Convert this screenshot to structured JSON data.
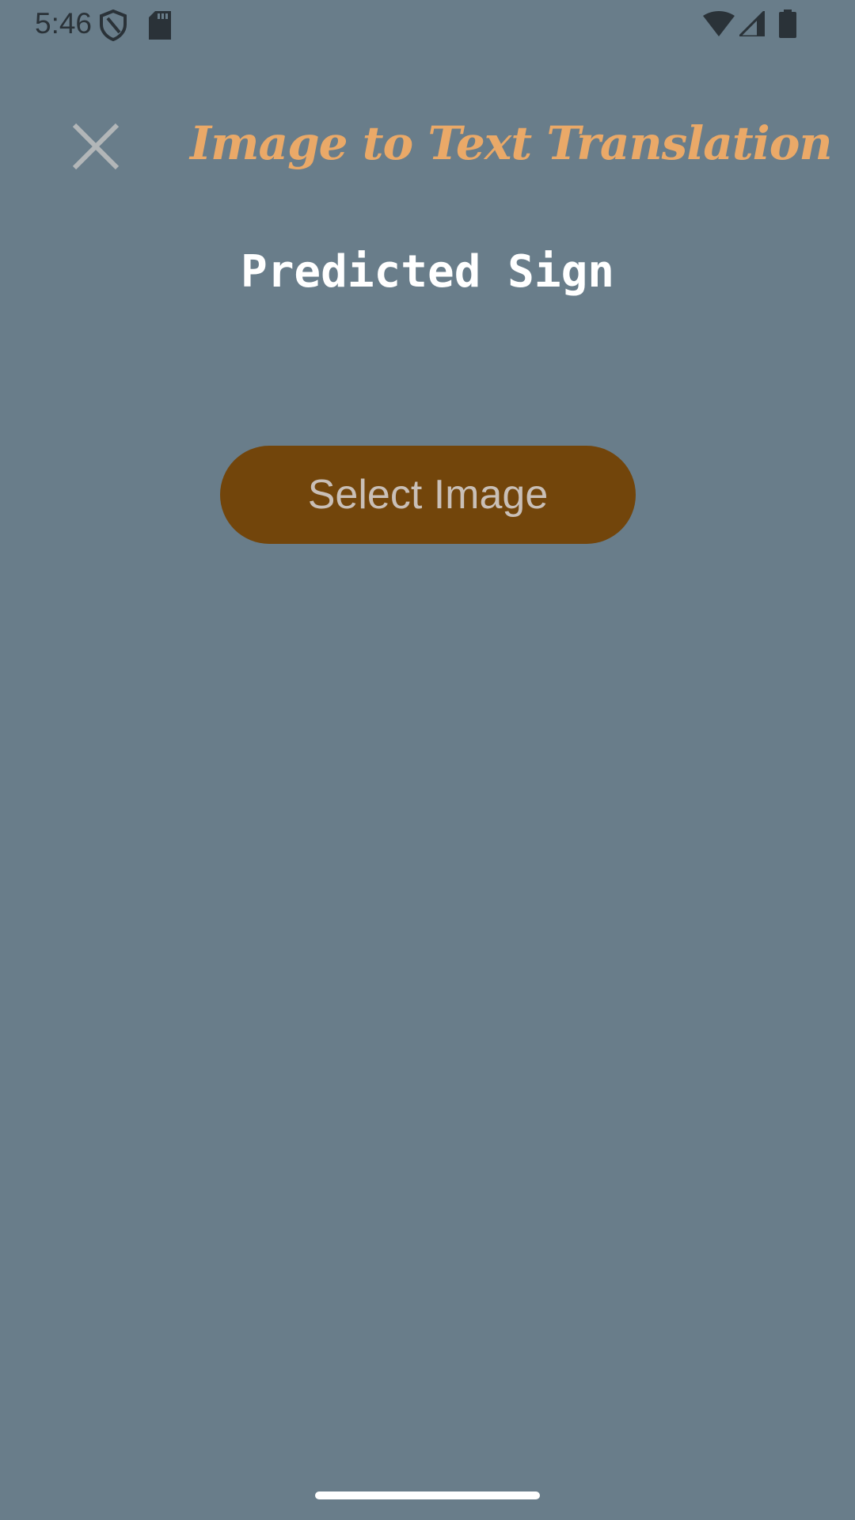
{
  "status_bar": {
    "time": "5:46",
    "icons_left": [
      "shield-icon",
      "sd-card-icon"
    ],
    "icons_right": [
      "wifi-icon",
      "cellular-signal-icon",
      "battery-icon"
    ],
    "icon_color": "#2a3238"
  },
  "header": {
    "close_icon": "close-icon",
    "title": "Image to Text Translation"
  },
  "main": {
    "predicted_label": "Predicted Sign",
    "select_button_label": "Select Image"
  },
  "colors": {
    "background": "#697d8a",
    "title": "#eaa968",
    "button_background": "#72450b",
    "button_text": "#c9bfb7"
  }
}
